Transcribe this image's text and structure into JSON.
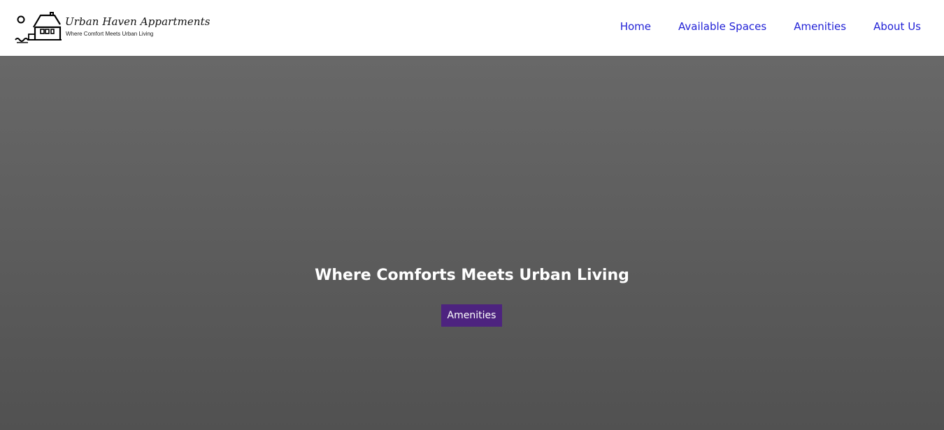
{
  "brand": {
    "name": "Urban Haven Appartments",
    "tagline": "Where Comfort Meets Urban Living",
    "logo_icon": "house-icon"
  },
  "nav": {
    "items": [
      {
        "label": "Home"
      },
      {
        "label": "Available Spaces"
      },
      {
        "label": "Amenities"
      },
      {
        "label": "About Us"
      }
    ],
    "link_color": "#1f1fd6"
  },
  "hero": {
    "title": "Where Comforts Meets Urban Living",
    "button_label": "Amenities",
    "button_color": "#4d237f",
    "background_top": "#686868",
    "background_bottom": "#515151"
  }
}
